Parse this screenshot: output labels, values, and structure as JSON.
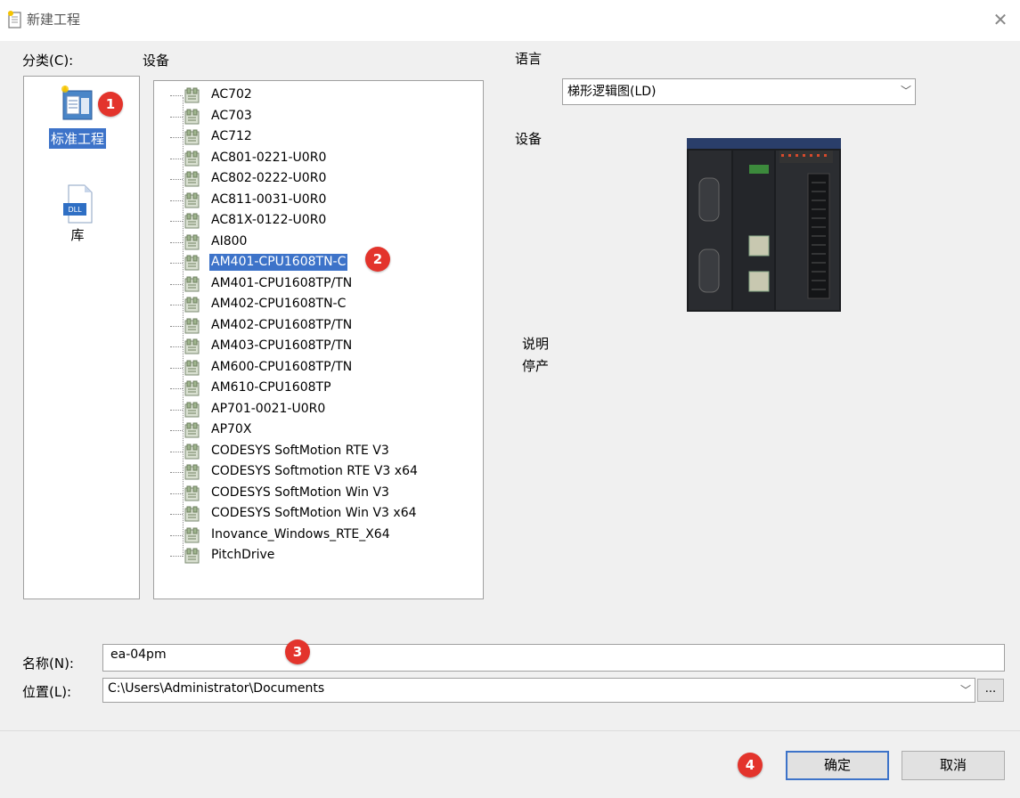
{
  "window": {
    "title": "新建工程"
  },
  "category": {
    "label": "分类(C):",
    "items": [
      {
        "label": "标准工程",
        "icon": "standard-project-icon",
        "selected": true
      },
      {
        "label": "库",
        "icon": "dll-library-icon",
        "selected": false
      }
    ]
  },
  "devices": {
    "label": "设备",
    "items": [
      "AC702",
      "AC703",
      "AC712",
      "AC801-0221-U0R0",
      "AC802-0222-U0R0",
      "AC811-0031-U0R0",
      "AC81X-0122-U0R0",
      "AI800",
      "AM401-CPU1608TN-C",
      "AM401-CPU1608TP/TN",
      "AM402-CPU1608TN-C",
      "AM402-CPU1608TP/TN",
      "AM403-CPU1608TP/TN",
      "AM600-CPU1608TP/TN",
      "AM610-CPU1608TP",
      "AP701-0021-U0R0",
      "AP70X",
      "CODESYS SoftMotion RTE V3",
      "CODESYS Softmotion RTE V3 x64",
      "CODESYS SoftMotion Win V3",
      "CODESYS SoftMotion Win V3 x64",
      "Inovance_Windows_RTE_X64",
      "PitchDrive"
    ],
    "selected_index": 8
  },
  "language": {
    "label": "语言",
    "value": "梯形逻辑图(LD)"
  },
  "device_preview": {
    "label": "设备"
  },
  "description": {
    "label": "说明",
    "text": "停产"
  },
  "name_field": {
    "label": "名称(N):",
    "value": "ea-04pm"
  },
  "location_field": {
    "label": "位置(L):",
    "value": "C:\\Users\\Administrator\\Documents",
    "browse": "..."
  },
  "buttons": {
    "ok": "确定",
    "cancel": "取消"
  },
  "badges": [
    "1",
    "2",
    "3",
    "4"
  ],
  "colors": {
    "selection": "#3d73c9",
    "badge": "#e3342c"
  }
}
